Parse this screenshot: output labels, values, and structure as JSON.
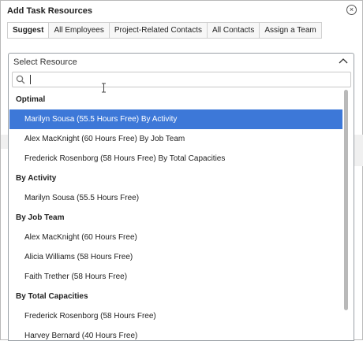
{
  "dialog": {
    "title": "Add Task Resources",
    "close_label": "×"
  },
  "tabs": [
    {
      "label": "Suggest",
      "active": true
    },
    {
      "label": "All Employees",
      "active": false
    },
    {
      "label": "Project-Related Contacts",
      "active": false
    },
    {
      "label": "All Contacts",
      "active": false
    },
    {
      "label": "Assign a Team",
      "active": false
    }
  ],
  "dropdown": {
    "placeholder": "Select Resource",
    "search_value": "",
    "expanded": true,
    "chevron_icon": "chevron-up-icon",
    "search_icon": "search-icon",
    "selected_color": "#3d78d8"
  },
  "list": {
    "optimal_header": "Optimal",
    "optimal_1": "Marilyn Sousa (55.5 Hours Free) By Activity",
    "optimal_2": "Alex MacKnight (60 Hours Free) By Job Team",
    "optimal_3": "Frederick Rosenborg (58 Hours Free) By Total Capacities",
    "activity_header": "By Activity",
    "activity_1": "Marilyn Sousa (55.5 Hours Free)",
    "jobteam_header": "By Job Team",
    "jobteam_1": "Alex MacKnight (60 Hours Free)",
    "jobteam_2": "Alicia Williams (58 Hours Free)",
    "jobteam_3": "Faith Trether (58 Hours Free)",
    "capacities_header": "By Total Capacities",
    "capacities_1": "Frederick Rosenborg (58 Hours Free)",
    "capacities_2": "Harvey Bernard (40 Hours Free)"
  }
}
